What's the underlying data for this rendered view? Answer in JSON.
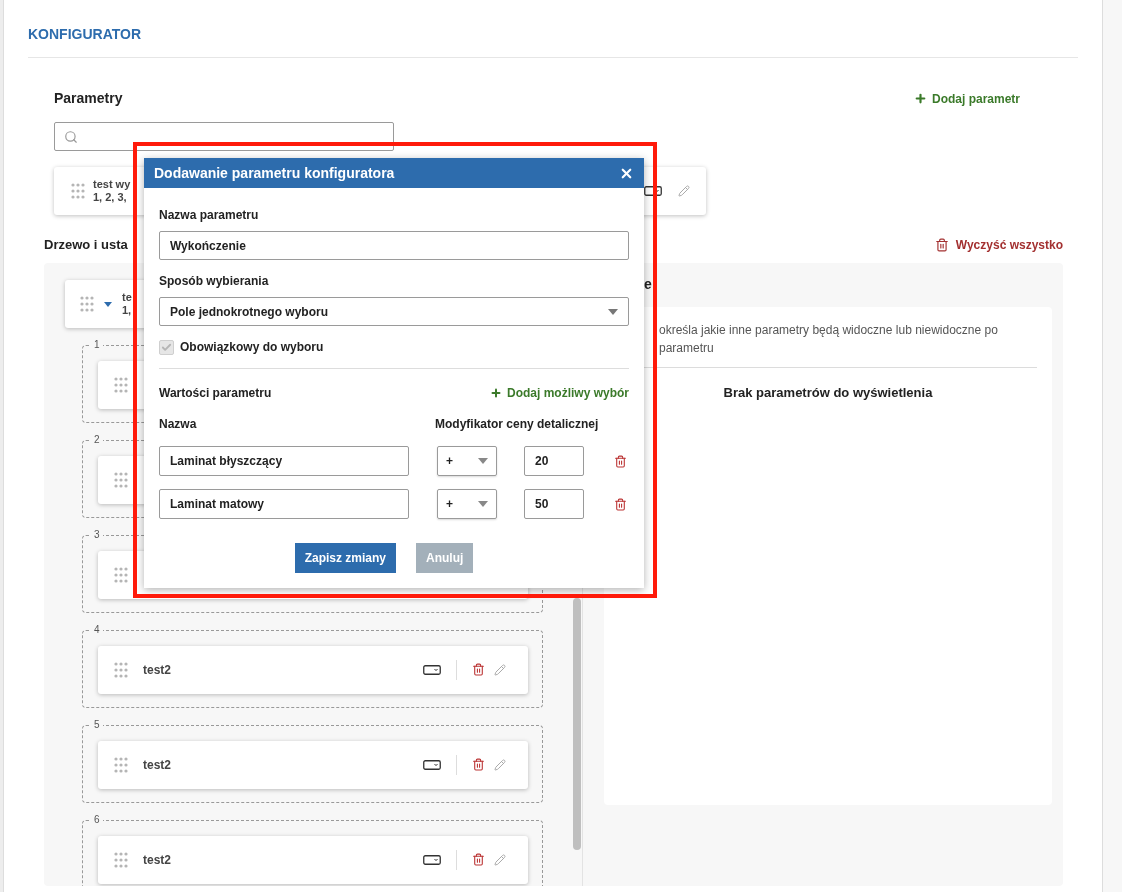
{
  "header": {
    "title": "KONFIGURATOR"
  },
  "parameters": {
    "title": "Parametry",
    "add_label": "Dodaj parametr",
    "items": [
      {
        "name": "test wy",
        "values": "1, 2, 3,"
      }
    ]
  },
  "tree": {
    "title": "Drzewo i usta",
    "clear_label": "Wyczyść wszystko",
    "root": {
      "name": "te",
      "values": "1,",
      "expanded": true,
      "children": [
        {
          "number": "1"
        },
        {
          "number": "2"
        },
        {
          "number": "3"
        },
        {
          "number": "4",
          "name": "test2"
        },
        {
          "number": "5",
          "name": "test2"
        },
        {
          "number": "6",
          "name": "test2"
        }
      ]
    }
  },
  "settings": {
    "title": "e",
    "description_lines": [
      "określa jakie inne parametry będą widoczne lub niewidoczne po",
      "parametru"
    ],
    "empty_message": "Brak parametrów do wyświetlenia"
  },
  "dialog": {
    "title": "Dodawanie parametru konfiguratora",
    "name_label": "Nazwa parametru",
    "name_value": "Wykończenie",
    "mode_label": "Sposób wybierania",
    "mode_value": "Pole jednokrotnego wyboru",
    "required": {
      "label": "Obowiązkowy do wyboru",
      "checked": true,
      "disabled": true
    },
    "values_title": "Wartości parametru",
    "add_choice_label": "Dodaj możliwy wybór",
    "columns": [
      "Nazwa",
      "Modyfikator ceny detalicznej"
    ],
    "rows": [
      {
        "name": "Laminat błyszczący",
        "sign": "+",
        "amount": "20"
      },
      {
        "name": "Laminat matowy",
        "sign": "+",
        "amount": "50"
      }
    ],
    "buttons": [
      {
        "label": "Zapisz zmiany",
        "kind": "primary"
      },
      {
        "label": "Anuluj",
        "kind": "secondary"
      }
    ]
  }
}
